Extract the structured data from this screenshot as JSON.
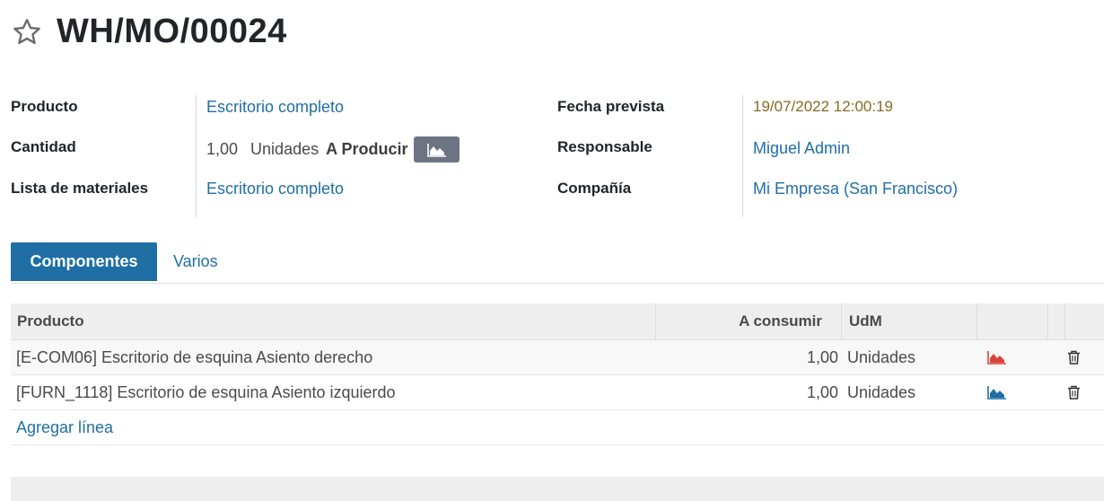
{
  "record": {
    "title": "WH/MO/00024"
  },
  "fields": {
    "producto_label": "Producto",
    "producto_value": "Escritorio completo",
    "cantidad_label": "Cantidad",
    "cantidad_value": "1,00",
    "cantidad_unit": "Unidades",
    "cantidad_suffix": "A Producir",
    "lista_label": "Lista de materiales",
    "lista_value": "Escritorio completo",
    "fecha_label": "Fecha prevista",
    "fecha_value": "19/07/2022 12:00:19",
    "responsable_label": "Responsable",
    "responsable_value": "Miguel Admin",
    "compania_label": "Compañía",
    "compania_value": "Mi Empresa (San Francisco)"
  },
  "tabs": [
    {
      "label": "Componentes",
      "active": true
    },
    {
      "label": "Varios",
      "active": false
    }
  ],
  "table": {
    "headers": {
      "producto": "Producto",
      "a_consumir": "A consumir",
      "udm": "UdM"
    },
    "rows": [
      {
        "producto": "[E-COM06] Escritorio de esquina Asiento derecho",
        "cantidad": "1,00",
        "udm": "Unidades",
        "forecast_color": "#d9443a"
      },
      {
        "producto": "[FURN_1118] Escritorio de esquina Asiento izquierdo",
        "cantidad": "1,00",
        "udm": "Unidades",
        "forecast_color": "#1f6fa5"
      }
    ],
    "add_line": "Agregar línea"
  },
  "colors": {
    "link": "#1f6fa5",
    "date": "#8a6a1e",
    "tab_active_bg": "#1f6fa5",
    "forecast_button": "#6c7484"
  }
}
